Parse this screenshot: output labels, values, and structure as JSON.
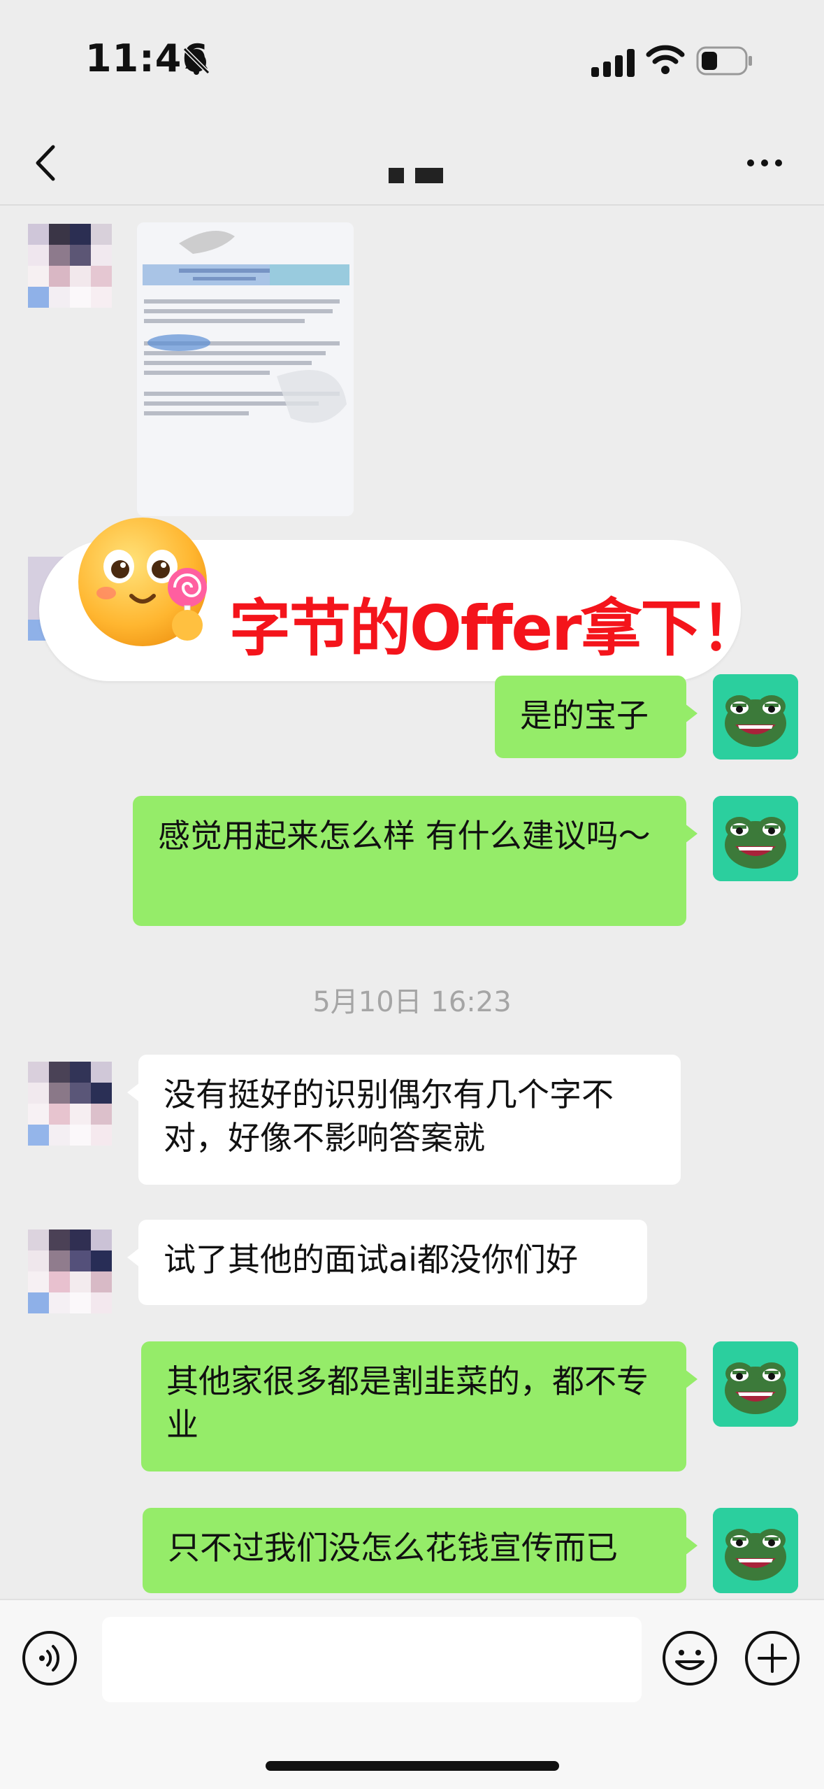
{
  "status_bar": {
    "time": "11:46"
  },
  "header": {
    "title": ""
  },
  "overlay": {
    "text": "字节的Offer拿下！"
  },
  "messages": {
    "m1": "是的宝子",
    "m2": "感觉用起来怎么样 有什么建议吗～",
    "timestamp": "5月10日 16:23",
    "m3": "没有挺好的识别偶尔有几个字不对，好像不影响答案就",
    "m4": "试了其他的面试ai都没你们好",
    "m5": "其他家很多都是割韭菜的，都不专业",
    "m6": "只不过我们没怎么花钱宣传而已"
  },
  "colors": {
    "my_bubble": "#95ec69",
    "overlay_text": "#f4141b",
    "background": "#ededed"
  },
  "icons": [
    "back-arrow-icon",
    "more-icon",
    "voice-icon",
    "emoji-icon",
    "plus-icon",
    "mute-bell-icon",
    "signal-icon",
    "wifi-icon",
    "battery-icon"
  ]
}
